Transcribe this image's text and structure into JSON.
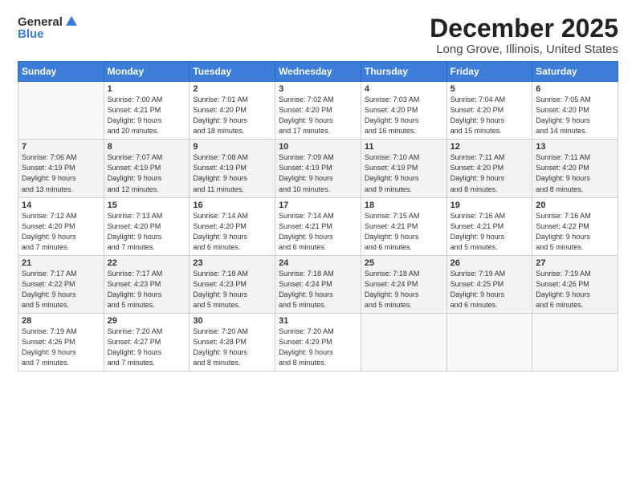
{
  "logo": {
    "line1": "General",
    "line2": "Blue"
  },
  "title": "December 2025",
  "location": "Long Grove, Illinois, United States",
  "headers": [
    "Sunday",
    "Monday",
    "Tuesday",
    "Wednesday",
    "Thursday",
    "Friday",
    "Saturday"
  ],
  "weeks": [
    [
      {
        "day": "",
        "info": ""
      },
      {
        "day": "1",
        "info": "Sunrise: 7:00 AM\nSunset: 4:21 PM\nDaylight: 9 hours\nand 20 minutes."
      },
      {
        "day": "2",
        "info": "Sunrise: 7:01 AM\nSunset: 4:20 PM\nDaylight: 9 hours\nand 18 minutes."
      },
      {
        "day": "3",
        "info": "Sunrise: 7:02 AM\nSunset: 4:20 PM\nDaylight: 9 hours\nand 17 minutes."
      },
      {
        "day": "4",
        "info": "Sunrise: 7:03 AM\nSunset: 4:20 PM\nDaylight: 9 hours\nand 16 minutes."
      },
      {
        "day": "5",
        "info": "Sunrise: 7:04 AM\nSunset: 4:20 PM\nDaylight: 9 hours\nand 15 minutes."
      },
      {
        "day": "6",
        "info": "Sunrise: 7:05 AM\nSunset: 4:20 PM\nDaylight: 9 hours\nand 14 minutes."
      }
    ],
    [
      {
        "day": "7",
        "info": "Sunrise: 7:06 AM\nSunset: 4:19 PM\nDaylight: 9 hours\nand 13 minutes."
      },
      {
        "day": "8",
        "info": "Sunrise: 7:07 AM\nSunset: 4:19 PM\nDaylight: 9 hours\nand 12 minutes."
      },
      {
        "day": "9",
        "info": "Sunrise: 7:08 AM\nSunset: 4:19 PM\nDaylight: 9 hours\nand 11 minutes."
      },
      {
        "day": "10",
        "info": "Sunrise: 7:09 AM\nSunset: 4:19 PM\nDaylight: 9 hours\nand 10 minutes."
      },
      {
        "day": "11",
        "info": "Sunrise: 7:10 AM\nSunset: 4:19 PM\nDaylight: 9 hours\nand 9 minutes."
      },
      {
        "day": "12",
        "info": "Sunrise: 7:11 AM\nSunset: 4:20 PM\nDaylight: 9 hours\nand 8 minutes."
      },
      {
        "day": "13",
        "info": "Sunrise: 7:11 AM\nSunset: 4:20 PM\nDaylight: 9 hours\nand 8 minutes."
      }
    ],
    [
      {
        "day": "14",
        "info": "Sunrise: 7:12 AM\nSunset: 4:20 PM\nDaylight: 9 hours\nand 7 minutes."
      },
      {
        "day": "15",
        "info": "Sunrise: 7:13 AM\nSunset: 4:20 PM\nDaylight: 9 hours\nand 7 minutes."
      },
      {
        "day": "16",
        "info": "Sunrise: 7:14 AM\nSunset: 4:20 PM\nDaylight: 9 hours\nand 6 minutes."
      },
      {
        "day": "17",
        "info": "Sunrise: 7:14 AM\nSunset: 4:21 PM\nDaylight: 9 hours\nand 6 minutes."
      },
      {
        "day": "18",
        "info": "Sunrise: 7:15 AM\nSunset: 4:21 PM\nDaylight: 9 hours\nand 6 minutes."
      },
      {
        "day": "19",
        "info": "Sunrise: 7:16 AM\nSunset: 4:21 PM\nDaylight: 9 hours\nand 5 minutes."
      },
      {
        "day": "20",
        "info": "Sunrise: 7:16 AM\nSunset: 4:22 PM\nDaylight: 9 hours\nand 5 minutes."
      }
    ],
    [
      {
        "day": "21",
        "info": "Sunrise: 7:17 AM\nSunset: 4:22 PM\nDaylight: 9 hours\nand 5 minutes."
      },
      {
        "day": "22",
        "info": "Sunrise: 7:17 AM\nSunset: 4:23 PM\nDaylight: 9 hours\nand 5 minutes."
      },
      {
        "day": "23",
        "info": "Sunrise: 7:18 AM\nSunset: 4:23 PM\nDaylight: 9 hours\nand 5 minutes."
      },
      {
        "day": "24",
        "info": "Sunrise: 7:18 AM\nSunset: 4:24 PM\nDaylight: 9 hours\nand 5 minutes."
      },
      {
        "day": "25",
        "info": "Sunrise: 7:18 AM\nSunset: 4:24 PM\nDaylight: 9 hours\nand 5 minutes."
      },
      {
        "day": "26",
        "info": "Sunrise: 7:19 AM\nSunset: 4:25 PM\nDaylight: 9 hours\nand 6 minutes."
      },
      {
        "day": "27",
        "info": "Sunrise: 7:19 AM\nSunset: 4:26 PM\nDaylight: 9 hours\nand 6 minutes."
      }
    ],
    [
      {
        "day": "28",
        "info": "Sunrise: 7:19 AM\nSunset: 4:26 PM\nDaylight: 9 hours\nand 7 minutes."
      },
      {
        "day": "29",
        "info": "Sunrise: 7:20 AM\nSunset: 4:27 PM\nDaylight: 9 hours\nand 7 minutes."
      },
      {
        "day": "30",
        "info": "Sunrise: 7:20 AM\nSunset: 4:28 PM\nDaylight: 9 hours\nand 8 minutes."
      },
      {
        "day": "31",
        "info": "Sunrise: 7:20 AM\nSunset: 4:29 PM\nDaylight: 9 hours\nand 8 minutes."
      },
      {
        "day": "",
        "info": ""
      },
      {
        "day": "",
        "info": ""
      },
      {
        "day": "",
        "info": ""
      }
    ]
  ]
}
